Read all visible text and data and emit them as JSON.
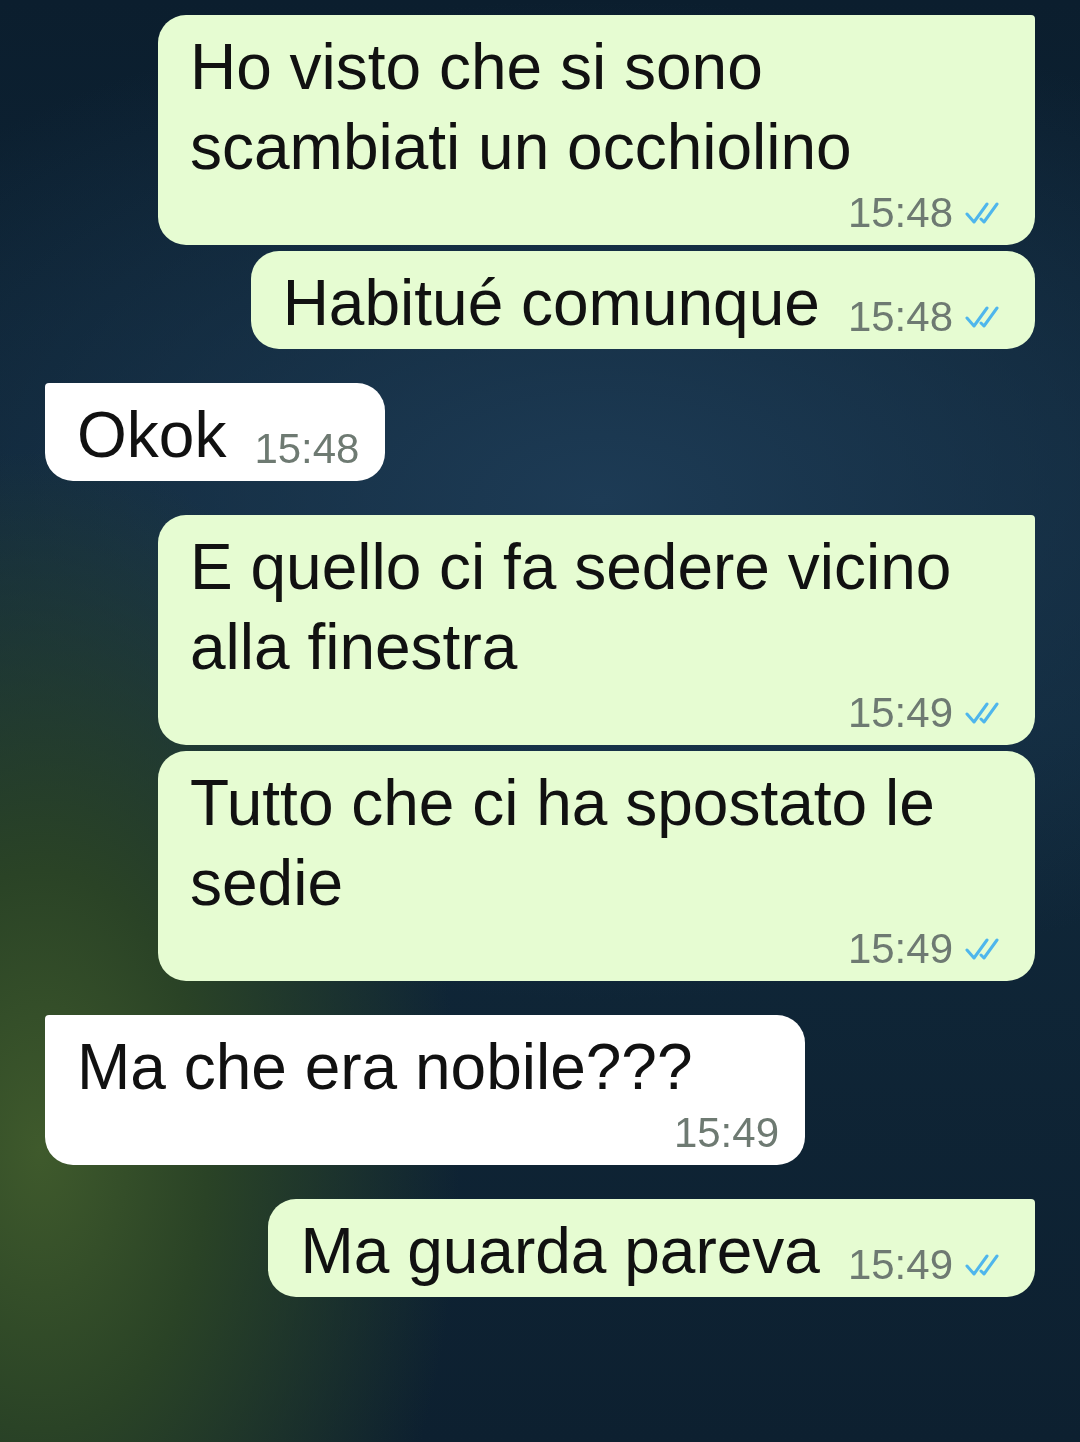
{
  "messages": [
    {
      "outgoing": true,
      "tail": true,
      "text": "Ho visto che si sono scambiati un occhiolino",
      "time": "15:48",
      "read": true
    },
    {
      "outgoing": true,
      "tail": false,
      "text": "Habitué comunque",
      "time": "15:48",
      "read": true
    },
    {
      "outgoing": false,
      "tail": true,
      "text": "Okok",
      "time": "15:48"
    },
    {
      "outgoing": true,
      "tail": true,
      "text": "E quello ci fa sedere vicino alla finestra",
      "time": "15:49",
      "read": true
    },
    {
      "outgoing": true,
      "tail": false,
      "text": "Tutto che ci ha spostato le sedie",
      "time": "15:49",
      "read": true
    },
    {
      "outgoing": false,
      "tail": true,
      "text": "Ma che era nobile???",
      "time": "15:49"
    },
    {
      "outgoing": true,
      "tail": true,
      "text": "Ma guarda pareva",
      "time": "15:49",
      "read": true
    }
  ]
}
